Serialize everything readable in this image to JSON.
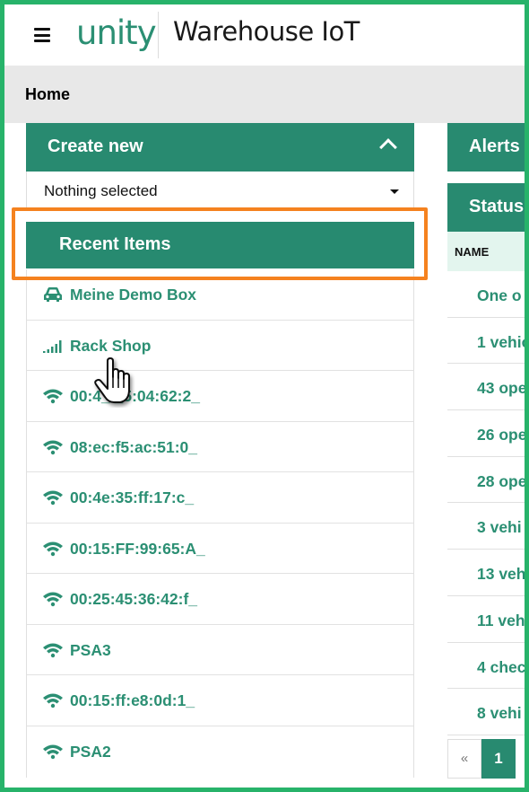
{
  "header": {
    "menu_icon": "hamburger-icon",
    "logo_text": "unity",
    "app_title": "Warehouse IoT"
  },
  "breadcrumb": {
    "current": "Home"
  },
  "create_new": {
    "title": "Create new",
    "collapse_icon": "chevron-up-icon",
    "select_value": "Nothing selected"
  },
  "recent_items": {
    "title": "Recent Items",
    "items": [
      {
        "label": "Meine Demo Box",
        "icon": "car-icon"
      },
      {
        "label": "Rack Shop",
        "icon": "signal-bars-icon"
      },
      {
        "label": "00:4_ _5:04:62:2_",
        "icon": "wifi-icon"
      },
      {
        "label": "08:ec:f5:ac:51:0_",
        "icon": "wifi-icon"
      },
      {
        "label": "00:4e:35:ff:17:c_",
        "icon": "wifi-icon"
      },
      {
        "label": "00:15:FF:99:65:A_",
        "icon": "wifi-icon"
      },
      {
        "label": "00:25:45:36:42:f_",
        "icon": "wifi-icon"
      },
      {
        "label": "PSA3",
        "icon": "wifi-icon"
      },
      {
        "label": "00:15:ff:e8:0d:1_",
        "icon": "wifi-icon"
      },
      {
        "label": "PSA2",
        "icon": "wifi-icon"
      }
    ]
  },
  "alerts": {
    "title": "Alerts"
  },
  "status": {
    "title": "Status",
    "column_header": "NAME",
    "rows": [
      "One o",
      "1 vehic",
      "43 ope",
      "26 ope",
      "28 ope",
      "3 vehi",
      "13 veh",
      "11 veh",
      "4 chec",
      "8 vehi"
    ]
  },
  "pager": {
    "prev": "«",
    "current": "1"
  },
  "colors": {
    "primary": "#288a70",
    "link": "#2b8f73",
    "highlight": "#f5821f",
    "frame": "#27b36a"
  }
}
